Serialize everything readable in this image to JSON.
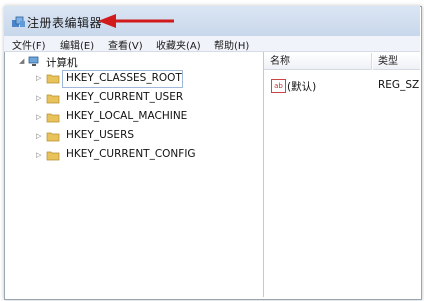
{
  "window": {
    "title": "注册表编辑器"
  },
  "menu": [
    {
      "label": "文件(F)"
    },
    {
      "label": "编辑(E)"
    },
    {
      "label": "查看(V)"
    },
    {
      "label": "收藏夹(A)"
    },
    {
      "label": "帮助(H)"
    }
  ],
  "tree": {
    "root": "计算机",
    "items": [
      {
        "label": "HKEY_CLASSES_ROOT",
        "selected": true
      },
      {
        "label": "HKEY_CURRENT_USER"
      },
      {
        "label": "HKEY_LOCAL_MACHINE"
      },
      {
        "label": "HKEY_USERS"
      },
      {
        "label": "HKEY_CURRENT_CONFIG"
      }
    ]
  },
  "list": {
    "columns": [
      {
        "label": "名称"
      },
      {
        "label": "类型"
      }
    ],
    "rows": [
      {
        "name": "(默认)",
        "type": "REG_SZ"
      }
    ]
  },
  "colors": {
    "arrow": "#d11a1a",
    "folder": "#e8c25a",
    "selection_border": "#9fb7d8"
  },
  "icons": {
    "app": "registry-editor-icon",
    "root": "computer-icon",
    "folder": "folder-icon",
    "value": "string-value-icon",
    "annotation": "red-arrow-icon"
  }
}
